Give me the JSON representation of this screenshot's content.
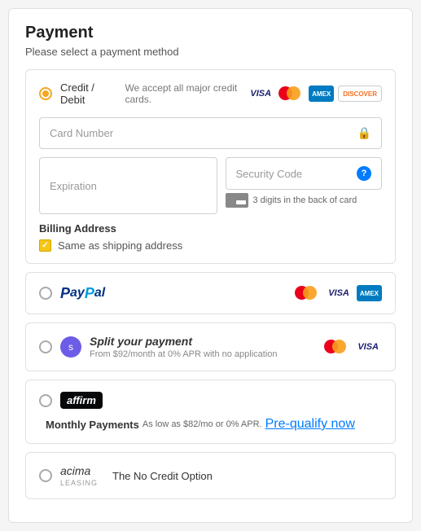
{
  "page": {
    "title": "Payment",
    "subtitle": "Please select a payment method"
  },
  "payment_methods": [
    {
      "id": "credit_debit",
      "label": "Credit / Debit",
      "sublabel": "We accept all major credit cards.",
      "selected": true
    },
    {
      "id": "paypal",
      "label": "PayPal",
      "selected": false
    },
    {
      "id": "splitit",
      "label": "Split your payment",
      "sublabel": "From $92/month at 0% APR with no application",
      "selected": false
    },
    {
      "id": "affirm",
      "label": "Monthly Payments",
      "sublabel": "As low as $82/mo or 0% APR.",
      "link_text": "Pre-qualify now",
      "selected": false
    },
    {
      "id": "acima",
      "label": "The No Credit Option",
      "selected": false
    }
  ],
  "form": {
    "card_number_placeholder": "Card Number",
    "expiration_placeholder": "Expiration",
    "security_code_placeholder": "Security Code",
    "security_hint": "3 digits in the back of card",
    "billing_title": "Billing Address",
    "same_as_shipping_label": "Same as shipping address"
  },
  "icons": {
    "lock": "🔒",
    "help": "?",
    "check": "✓"
  }
}
